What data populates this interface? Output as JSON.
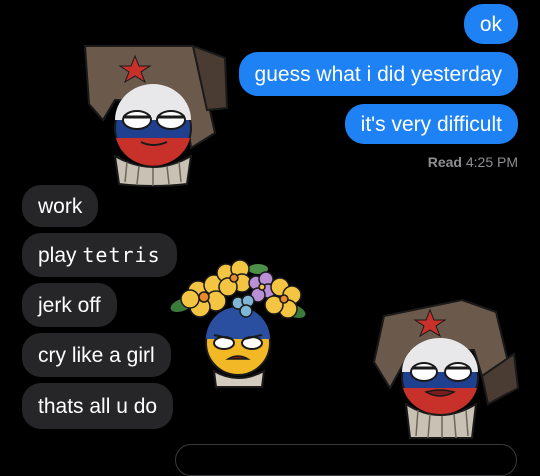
{
  "messages": {
    "sent": [
      "ok",
      "guess what i did yesterday",
      "it's very difficult"
    ],
    "read_label": "Read",
    "read_time": "4:25 PM",
    "received": [
      {
        "text": "work"
      },
      {
        "text": "play ",
        "extra": "tetris"
      },
      {
        "text": "jerk off"
      },
      {
        "text": "cry like a girl"
      },
      {
        "text": "thats all u do"
      }
    ]
  },
  "colors": {
    "sent_bubble": "#1e82f5",
    "received_bubble": "#262628",
    "background": "#000000"
  }
}
